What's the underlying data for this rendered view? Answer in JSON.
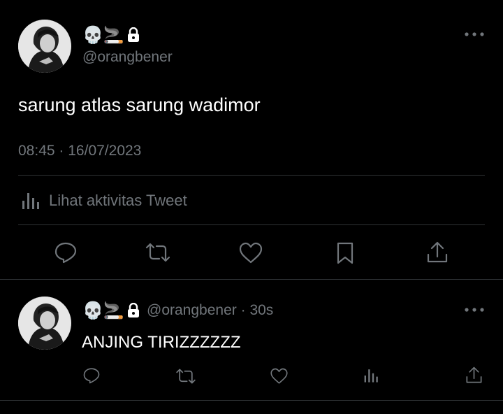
{
  "main_tweet": {
    "display_name_emojis": "💀🚬",
    "handle": "@orangbener",
    "text": "sarung atlas sarung wadimor",
    "time": "08:45",
    "separator": "·",
    "date": "16/07/2023",
    "activity_label": "Lihat aktivitas Tweet"
  },
  "reply_tweet": {
    "display_name_emojis": "💀🚬",
    "handle": "@orangbener",
    "separator": "·",
    "age": "30s",
    "text": "ANJING TIRIZZZZZZ"
  },
  "icons": {
    "lock": "lock-icon",
    "more": "more-icon",
    "reply": "reply-icon",
    "retweet": "retweet-icon",
    "like": "like-icon",
    "bookmark": "bookmark-icon",
    "share": "share-icon",
    "analytics": "analytics-icon"
  },
  "colors": {
    "background": "#000000",
    "muted": "#71767b",
    "divider": "#2f3336",
    "text": "#ffffff"
  }
}
